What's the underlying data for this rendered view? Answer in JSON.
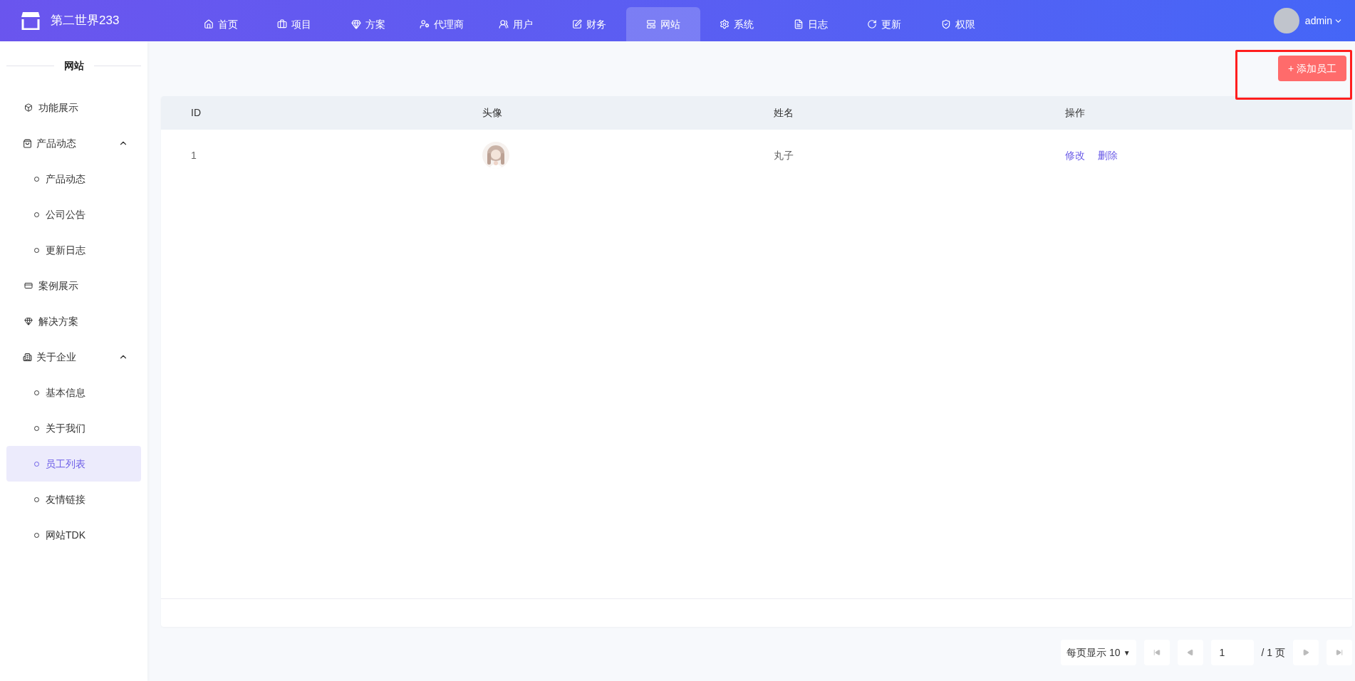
{
  "brand": "第二世界233",
  "nav": [
    {
      "label": "首页",
      "selected": false
    },
    {
      "label": "项目",
      "selected": false
    },
    {
      "label": "方案",
      "selected": false
    },
    {
      "label": "代理商",
      "selected": false
    },
    {
      "label": "用户",
      "selected": false
    },
    {
      "label": "财务",
      "selected": false
    },
    {
      "label": "网站",
      "selected": true
    },
    {
      "label": "系统",
      "selected": false
    },
    {
      "label": "日志",
      "selected": false
    },
    {
      "label": "更新",
      "selected": false
    },
    {
      "label": "权限",
      "selected": false
    }
  ],
  "user": {
    "name": "admin"
  },
  "sidebar": {
    "title": "网站",
    "items": [
      {
        "label": "功能展示",
        "selected": false
      },
      {
        "label": "产品动态",
        "expanded": true,
        "children": [
          {
            "label": "产品动态",
            "selected": false
          },
          {
            "label": "公司公告",
            "selected": false
          },
          {
            "label": "更新日志",
            "selected": false
          }
        ]
      },
      {
        "label": "案例展示",
        "selected": false
      },
      {
        "label": "解决方案",
        "selected": false
      },
      {
        "label": "关于企业",
        "expanded": true,
        "children": [
          {
            "label": "基本信息",
            "selected": false
          },
          {
            "label": "关于我们",
            "selected": false
          },
          {
            "label": "员工列表",
            "selected": true
          },
          {
            "label": "友情链接",
            "selected": false
          },
          {
            "label": "网站TDK",
            "selected": false
          }
        ]
      }
    ]
  },
  "add_button": {
    "label": "+ 添加员工",
    "highlighted": true
  },
  "table": {
    "columns": [
      "ID",
      "头像",
      "姓名",
      "操作"
    ],
    "rows": [
      {
        "id": "1",
        "name": "丸子",
        "actions": [
          "修改",
          "删除"
        ]
      }
    ]
  },
  "pagination": {
    "page_size": "每页显示 10",
    "caret": "▼",
    "page": "1",
    "total": "/ 1 页"
  }
}
